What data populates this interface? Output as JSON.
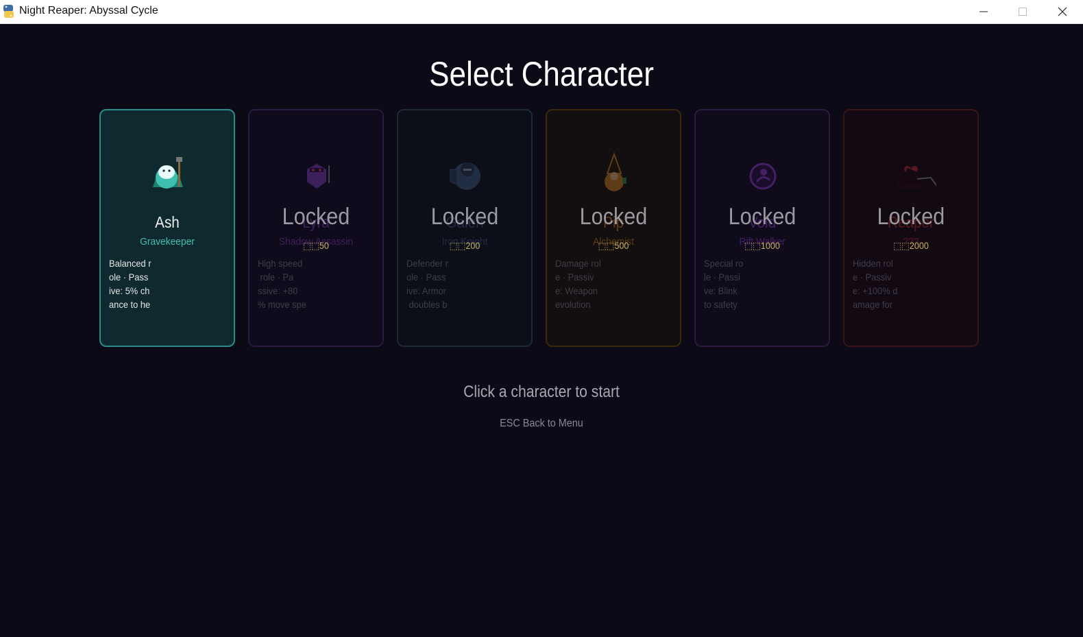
{
  "window": {
    "title": "Night Reaper: Abyssal Cycle"
  },
  "screen": {
    "heading": "Select Character",
    "hint": "Click a character to start",
    "back": "ESC Back to Menu",
    "locked_label": "Locked"
  },
  "characters": [
    {
      "name": "Ash",
      "role": "Gravekeeper",
      "desc": "Balanced r\nole · Pass\nive: 5% ch\nance to he",
      "locked": false,
      "cost": "",
      "color": "#3fbfb0",
      "bg": "#0f2a2e",
      "border": "#2a8c86",
      "icon": "gravekeeper-portrait-icon"
    },
    {
      "name": "Lyra",
      "role": "Shadow Assassin",
      "desc": "High speed\n role · Pa\nssive: +80\n% move spe",
      "locked": true,
      "cost": "⬚⬚50",
      "color": "#7a3ab0",
      "bg": "#160f24",
      "border": "#2a1c40",
      "icon": "assassin-portrait-icon"
    },
    {
      "name": "Galen",
      "role": "Iron Knight",
      "desc": "Defender r\nole · Pass\nive: Armor\n doubles b",
      "locked": true,
      "cost": "⬚⬚200",
      "color": "#3d5a78",
      "bg": "#0f141c",
      "border": "#1e2a36",
      "icon": "knight-portrait-icon"
    },
    {
      "name": "Pip",
      "role": "Alchemist",
      "desc": "Damage rol\ne · Passiv\ne: Weapon\nevolution",
      "locked": true,
      "cost": "⬚⬚500",
      "color": "#c07a18",
      "bg": "#1e1608",
      "border": "#3a2a0c",
      "icon": "alchemist-portrait-icon"
    },
    {
      "name": "Void",
      "role": "Rift Walker",
      "desc": "Special ro\nle · Passi\nve: Blink\nto safety",
      "locked": true,
      "cost": "⬚⬚1000",
      "color": "#8a3ac0",
      "bg": "#170f22",
      "border": "#2c1a40",
      "icon": "rift-walker-portrait-icon"
    },
    {
      "name": "Reaper",
      "role": "???",
      "desc": "Hidden rol\ne · Passiv\ne: +100% d\namage for",
      "locked": true,
      "cost": "⬚⬚2000",
      "color": "#b02a2a",
      "bg": "#1c0a10",
      "border": "#3a1418",
      "icon": "reaper-portrait-icon"
    }
  ]
}
